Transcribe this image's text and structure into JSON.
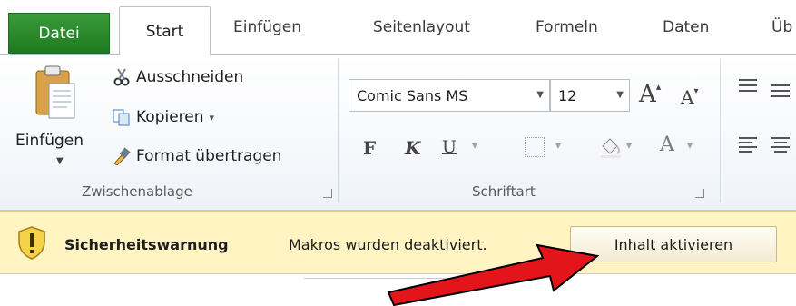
{
  "tabs": [
    "Datei",
    "Start",
    "Einfügen",
    "Seitenlayout",
    "Formeln",
    "Daten",
    "Üb"
  ],
  "clipboard": {
    "paste_label": "Einfügen",
    "cut_label": "Ausschneiden",
    "copy_label": "Kopieren",
    "copy_caret": "▾",
    "format_painter_label": "Format übertragen",
    "group_label": "Zwischenablage"
  },
  "font": {
    "font_name": "Comic Sans MS",
    "font_size": "12",
    "grow_label": "A",
    "shrink_label": "A",
    "bold_label": "F",
    "italic_label": "K",
    "underline_label": "U",
    "font_color_label": "A",
    "group_label": "Schriftart"
  },
  "warning": {
    "title": "Sicherheitswarnung",
    "message": "Makros wurden deaktiviert.",
    "button_label": "Inhalt aktivieren"
  },
  "colors": {
    "file_tab": "#1e7a1f",
    "warning_bar": "#fff4c2",
    "arrow": "#e4141b"
  },
  "icons": [
    "paste-icon",
    "scissors-icon",
    "copy-icon",
    "format-painter-icon",
    "grow-font-icon",
    "shrink-font-icon",
    "border-icon",
    "fill-color-icon",
    "font-color-icon",
    "align-icon",
    "shield-warning-icon",
    "red-arrow-icon"
  ]
}
